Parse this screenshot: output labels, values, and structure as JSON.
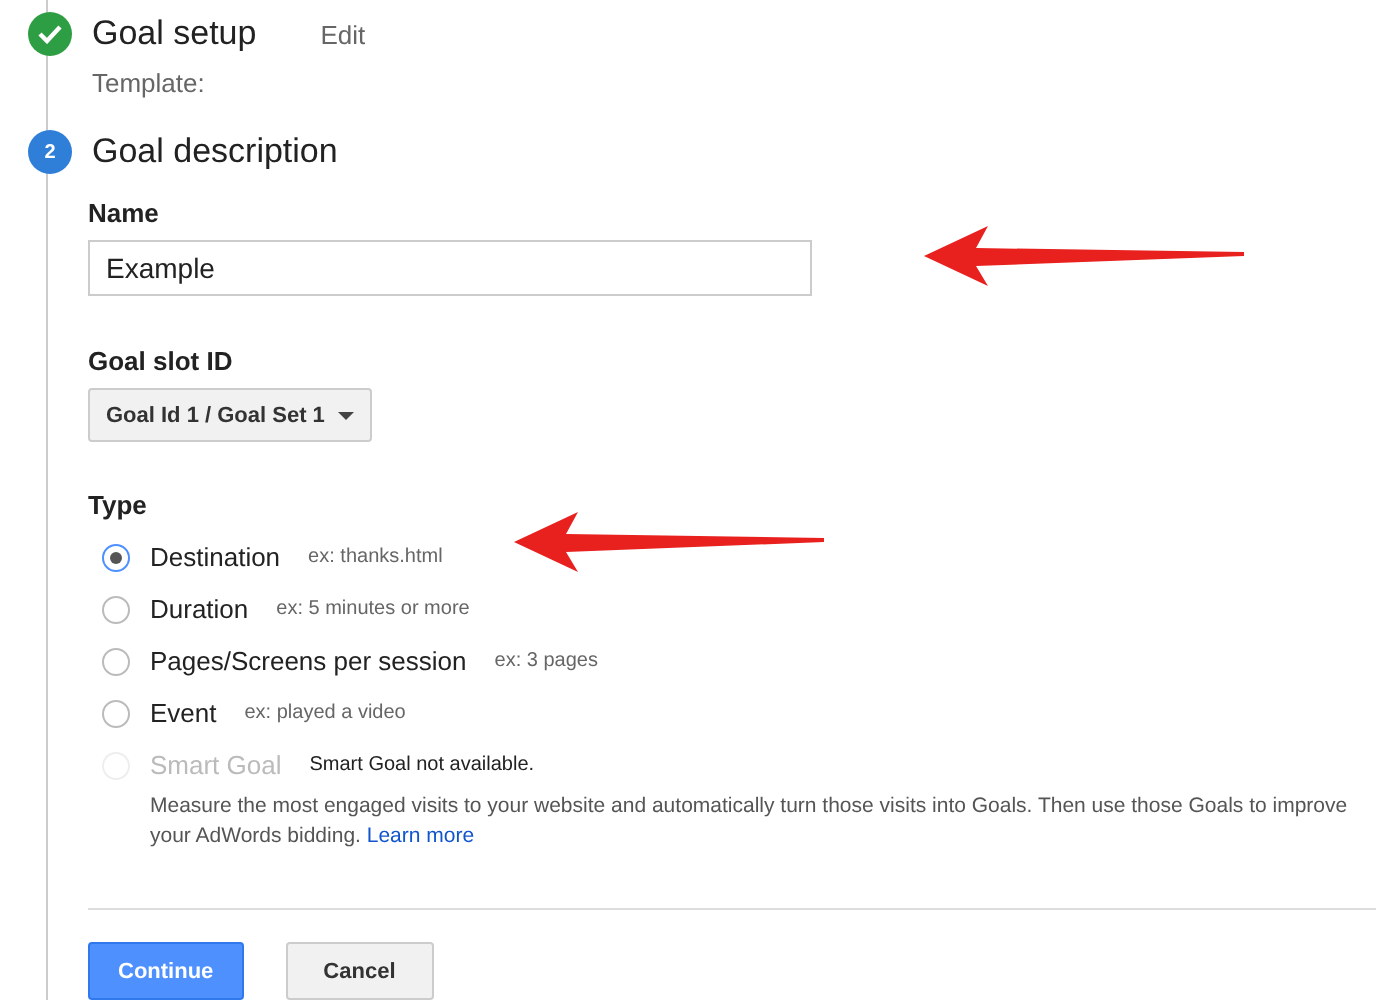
{
  "steps": [
    {
      "completed": true,
      "title": "Goal setup",
      "action": "Edit",
      "subtitle": "Template:"
    },
    {
      "completed": false,
      "number": "2",
      "title": "Goal description"
    }
  ],
  "name_field": {
    "label": "Name",
    "value": "Example"
  },
  "slot": {
    "label": "Goal slot ID",
    "value": "Goal Id 1 / Goal Set 1"
  },
  "type": {
    "label": "Type",
    "options": [
      {
        "label": "Destination",
        "hint": "ex: thanks.html",
        "selected": true,
        "disabled": false
      },
      {
        "label": "Duration",
        "hint": "ex: 5 minutes or more",
        "selected": false,
        "disabled": false
      },
      {
        "label": "Pages/Screens per session",
        "hint": "ex: 3 pages",
        "selected": false,
        "disabled": false
      },
      {
        "label": "Event",
        "hint": "ex: played a video",
        "selected": false,
        "disabled": false
      },
      {
        "label": "Smart Goal",
        "hint": "Smart Goal not available.",
        "selected": false,
        "disabled": true
      }
    ],
    "note": "Measure the most engaged visits to your website and automatically turn those visits into Goals. Then use those Goals to improve your AdWords bidding.",
    "note_link": "Learn more"
  },
  "buttons": [
    {
      "label": "Continue",
      "kind": "primary"
    },
    {
      "label": "Cancel",
      "kind": "secondary"
    }
  ],
  "annotations": [
    {
      "kind": "arrow"
    },
    {
      "kind": "arrow"
    }
  ]
}
